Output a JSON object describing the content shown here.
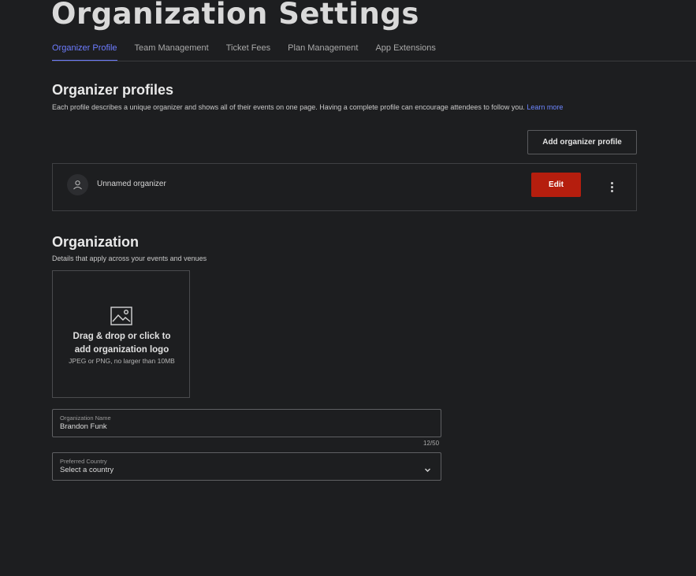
{
  "page_title": "Organization Settings",
  "tabs": [
    {
      "label": "Organizer Profile",
      "active": true
    },
    {
      "label": "Team Management",
      "active": false
    },
    {
      "label": "Ticket Fees",
      "active": false
    },
    {
      "label": "Plan Management",
      "active": false
    },
    {
      "label": "App Extensions",
      "active": false
    }
  ],
  "organizer_profiles": {
    "title": "Organizer profiles",
    "description": "Each profile describes a unique organizer and shows all of their events on one page. Having a complete profile can encourage attendees to follow you.",
    "learn_more": "Learn more",
    "add_button": "Add organizer profile",
    "profiles": [
      {
        "name": "Unnamed organizer",
        "avatar_icon": "user-icon",
        "edit_label": "Edit",
        "menu_icon": "kebab-menu-icon"
      }
    ]
  },
  "organization": {
    "title": "Organization",
    "description": "Details that apply across your events and venues",
    "logo_upload": {
      "icon": "image-icon",
      "title_line1": "Drag & drop or click to",
      "title_line2": "add organization logo",
      "hint": "JPEG or PNG, no larger than 10MB"
    },
    "name_field": {
      "label": "Organization Name",
      "value": "Brandon Funk",
      "char_count": "12/50"
    },
    "country_field": {
      "label": "Preferred Country",
      "value": "Select a country",
      "icon": "chevron-down-icon"
    }
  },
  "colors": {
    "background": "#1d1e20",
    "accent": "#6d7cff",
    "edit_button": "#b51e0e",
    "link": "#6d86ff"
  }
}
